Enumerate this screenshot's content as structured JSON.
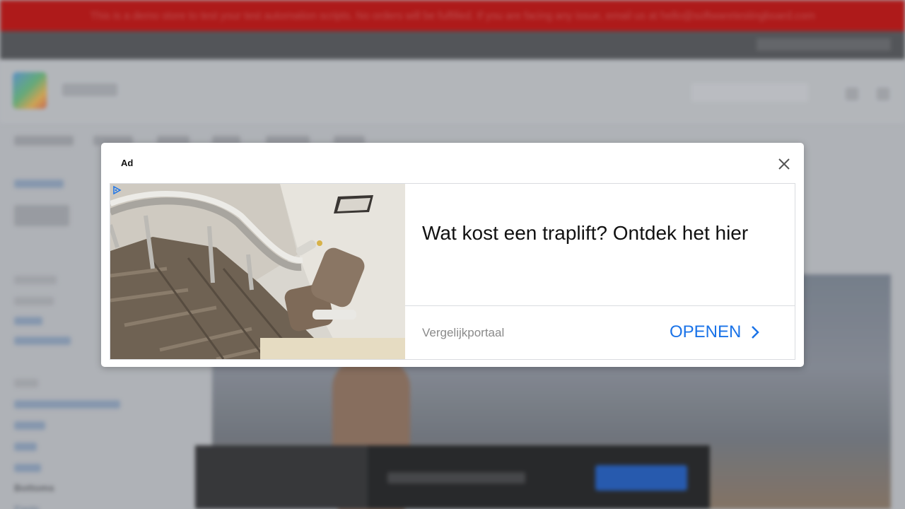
{
  "background": {
    "notice_text": "This is a demo store to test your test automation scripts. No orders will be fulfilled. If you are facing any issue, email us at hello@softwaretestingboard.com",
    "sidebar_links": [
      "Pants"
    ],
    "sidebar_heading": "Bottoms"
  },
  "ad": {
    "label": "Ad",
    "headline": "Wat kost een traplift? Ontdek het hier",
    "advertiser": "Vergelijkportaal",
    "cta_label": "OPENEN",
    "icons": [
      "close-icon",
      "adchoices-icon",
      "chevron-right-icon"
    ],
    "accent_color": "#1a73e8"
  }
}
